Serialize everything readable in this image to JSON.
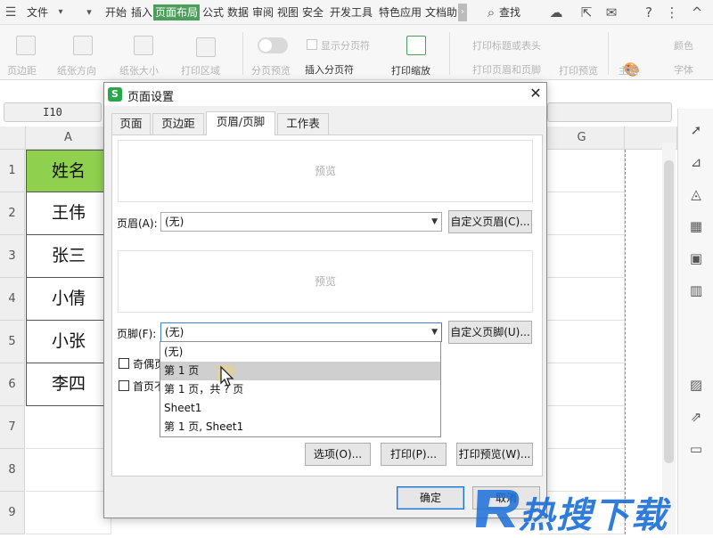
{
  "menubar": {
    "file_label": "文件",
    "items": [
      "开始",
      "插入",
      "页面布局",
      "公式",
      "数据",
      "审阅",
      "视图",
      "安全",
      "开发工具",
      "特色应用",
      "文档助"
    ],
    "active_index": 2,
    "search_label": "查找",
    "help_glyph": "?",
    "more_glyph": "⋮",
    "collapse_glyph": "^"
  },
  "ribbon": {
    "margin_label": "页边距",
    "orientation_label": "纸张方向",
    "size_label": "纸张大小",
    "print_area_label": "打印区域",
    "page_break_preview_label": "分页预览",
    "show_page_break_label": "显示分页符",
    "insert_page_break_label": "插入分页符",
    "print_scale_label": "打印缩放",
    "print_titles_label": "打印标题或表头",
    "print_header_footer_label": "打印页眉和页脚",
    "print_preview_label": "打印预览",
    "theme_label": "主题",
    "colors_label": "颜色",
    "fonts_label": "字体"
  },
  "formula": {
    "namebox": "I10"
  },
  "grid": {
    "col_a": "A",
    "col_g": "G",
    "rows": [
      "1",
      "2",
      "3",
      "4",
      "5",
      "6",
      "7",
      "8",
      "9"
    ],
    "cells": [
      "姓名",
      "王伟",
      "张三",
      "小倩",
      "小张",
      "李四"
    ],
    "header_fill": "#8fd14f"
  },
  "dialog": {
    "title": "页面设置",
    "logo": "S",
    "close_glyph": "✕",
    "tabs": [
      "页面",
      "页边距",
      "页眉/页脚",
      "工作表"
    ],
    "active_tab": 2,
    "header_preview": "预览",
    "header_label": "页眉(A):",
    "header_value": "(无)",
    "custom_header_btn": "自定义页眉(C)...",
    "footer_preview": "预览",
    "footer_label": "页脚(F):",
    "footer_value": "(无)",
    "custom_footer_btn": "自定义页脚(U)...",
    "odd_even_label": "奇偶页",
    "first_page_label": "首页不",
    "options_btn": "选项(O)...",
    "print_btn": "打印(P)...",
    "print_preview_btn": "打印预览(W)...",
    "ok_btn": "确定",
    "cancel_btn": "取消",
    "footer_options": [
      "(无)",
      "第 1 页",
      "第 1 页，共 ? 页",
      "Sheet1",
      "第 1 页, Sheet1"
    ],
    "highlighted_option": 1
  },
  "watermark": {
    "text": "热搜下载",
    "color": "#1a6ed8"
  }
}
